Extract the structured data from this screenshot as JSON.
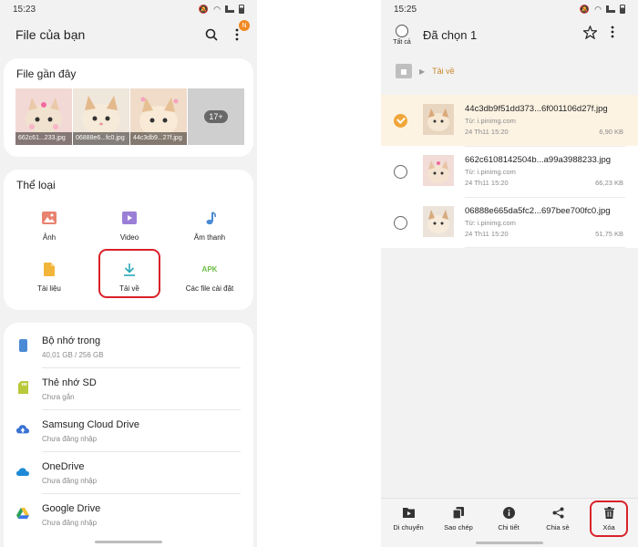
{
  "left": {
    "status": {
      "time": "15:23"
    },
    "header": {
      "title": "File của bạn",
      "badge": "N"
    },
    "recent": {
      "title": "File gần đây",
      "items": [
        {
          "caption": "662c61...233.jpg"
        },
        {
          "caption": "06888e6...fc0.jpg"
        },
        {
          "caption": "44c3db9...27f.jpg"
        }
      ],
      "more_count": "17+"
    },
    "categories": {
      "title": "Thể loại",
      "items": [
        {
          "label": "Ảnh",
          "icon": "image-icon"
        },
        {
          "label": "Video",
          "icon": "video-icon"
        },
        {
          "label": "Âm thanh",
          "icon": "music-note-icon"
        },
        {
          "label": "Tài liệu",
          "icon": "document-icon"
        },
        {
          "label": "Tải về",
          "icon": "download-icon"
        },
        {
          "label": "Các file cài đặt",
          "icon": "apk-icon",
          "glyph": "APK"
        }
      ]
    },
    "storage": [
      {
        "name": "Bộ nhớ trong",
        "sub": "40,01 GB / 256 GB",
        "icon": "phone-storage-icon"
      },
      {
        "name": "Thẻ nhớ SD",
        "sub": "Chưa gắn",
        "icon": "sd-card-icon"
      },
      {
        "name": "Samsung Cloud Drive",
        "sub": "Chưa đăng nhập",
        "icon": "samsung-cloud-icon"
      },
      {
        "name": "OneDrive",
        "sub": "Chưa đăng nhập",
        "icon": "onedrive-icon"
      },
      {
        "name": "Google Drive",
        "sub": "Chưa đăng nhập",
        "icon": "google-drive-icon"
      }
    ]
  },
  "right": {
    "status": {
      "time": "15:25"
    },
    "header": {
      "select_all": "Tất cả",
      "title": "Đã chọn 1"
    },
    "breadcrumb": {
      "folder": "Tải về"
    },
    "files": [
      {
        "name": "44c3db9f51dd373...6f001106d27f.jpg",
        "source": "Từ: i.pinimg.com",
        "date": "24 Th11 15:20",
        "size": "6,90 KB",
        "selected": true
      },
      {
        "name": "662c6108142504b...a99a3988233.jpg",
        "source": "Từ: i.pinimg.com",
        "date": "24 Th11 15:20",
        "size": "66,23 KB",
        "selected": false
      },
      {
        "name": "06888e665da5fc2...697bee700fc0.jpg",
        "source": "Từ: i.pinimg.com",
        "date": "24 Th11 15:20",
        "size": "51,75 KB",
        "selected": false
      }
    ],
    "bottom_actions": [
      {
        "label": "Di chuyển",
        "icon": "move-icon"
      },
      {
        "label": "Sao chép",
        "icon": "copy-icon"
      },
      {
        "label": "Chi tiết",
        "icon": "info-icon"
      },
      {
        "label": "Chia sẻ",
        "icon": "share-icon"
      },
      {
        "label": "Xóa",
        "icon": "trash-icon"
      }
    ]
  },
  "colors": {
    "accent_orange": "#f0a63a",
    "highlight_red": "#d9222a",
    "folder_text": "#c8892a"
  }
}
